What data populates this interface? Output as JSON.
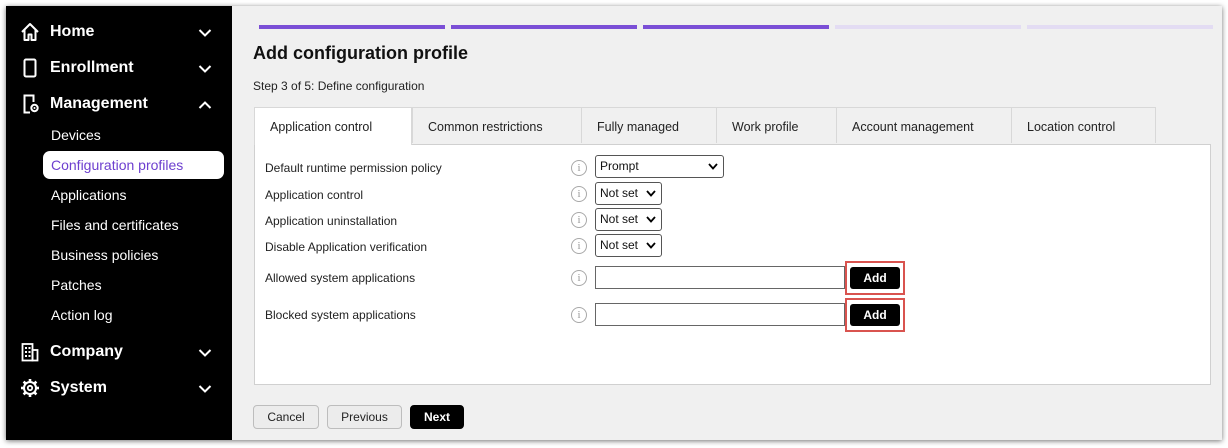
{
  "sidebar": {
    "groups": {
      "home": {
        "label": "Home",
        "icon": "home-icon"
      },
      "enrollment": {
        "label": "Enrollment",
        "icon": "phone-icon"
      },
      "management": {
        "label": "Management",
        "icon": "device-gear-icon"
      },
      "company": {
        "label": "Company",
        "icon": "building-icon"
      },
      "system": {
        "label": "System",
        "icon": "gear-icon"
      }
    },
    "management_items": [
      {
        "label": "Devices"
      },
      {
        "label": "Configuration profiles",
        "active": true
      },
      {
        "label": "Applications"
      },
      {
        "label": "Files and certificates"
      },
      {
        "label": "Business policies"
      },
      {
        "label": "Patches"
      },
      {
        "label": "Action log"
      }
    ]
  },
  "main": {
    "title": "Add configuration profile",
    "step": "Step 3 of 5: Define configuration",
    "progress": {
      "current_step": 3,
      "total_steps": 5,
      "active_color": "#7b4fd6",
      "inactive_color": "#e3dcf3"
    },
    "tabs": [
      {
        "label": "Application control",
        "active": true
      },
      {
        "label": "Common restrictions"
      },
      {
        "label": "Fully managed"
      },
      {
        "label": "Work profile"
      },
      {
        "label": "Account management"
      },
      {
        "label": "Location control"
      }
    ],
    "fields": {
      "runtime_permission": {
        "label": "Default runtime permission policy",
        "value": "Prompt"
      },
      "application_control": {
        "label": "Application control",
        "value": "Not set"
      },
      "application_uninstallation": {
        "label": "Application uninstallation",
        "value": "Not set"
      },
      "disable_verification": {
        "label": "Disable Application verification",
        "value": "Not set"
      },
      "allowed_system_apps": {
        "label": "Allowed system applications",
        "value": "",
        "button": "Add"
      },
      "blocked_system_apps": {
        "label": "Blocked system applications",
        "value": "",
        "button": "Add"
      }
    },
    "info_glyph": "i",
    "highlight_color": "#d9534f"
  },
  "footer": {
    "cancel": "Cancel",
    "previous": "Previous",
    "next": "Next"
  }
}
